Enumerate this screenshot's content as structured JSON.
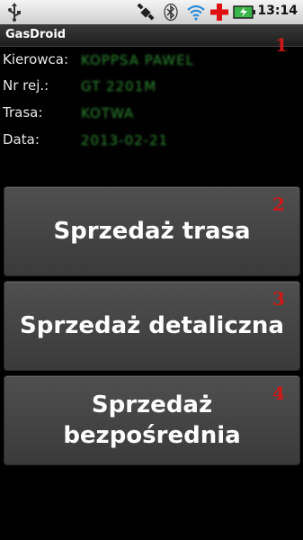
{
  "status_bar": {
    "time": "13:14",
    "icons": [
      "usb-icon",
      "gps-icon",
      "bluetooth-icon",
      "wifi-icon",
      "red-cross-icon",
      "battery-icon"
    ]
  },
  "app": {
    "title": "GasDroid"
  },
  "annotations": {
    "badge_1": "1",
    "badge_2": "2",
    "badge_3": "3",
    "badge_4": "4"
  },
  "info": {
    "driver": {
      "label": "Kierowca:",
      "value": "KOPPSA PAWEL"
    },
    "registration": {
      "label": "Nr rej.:",
      "value": "GT 2201M"
    },
    "route": {
      "label": "Trasa:",
      "value": "KOTWA"
    },
    "date": {
      "label": "Data:",
      "value": "2013-02-21"
    }
  },
  "buttons": {
    "route_sale": "Sprzedaż trasa",
    "retail_sale": "Sprzedaż detaliczna",
    "direct_sale": "Sprzedaż bezpośrednia"
  },
  "colors": {
    "value_green": "#2f8b32",
    "badge_red": "#d01818",
    "button_bg": "#474747"
  }
}
